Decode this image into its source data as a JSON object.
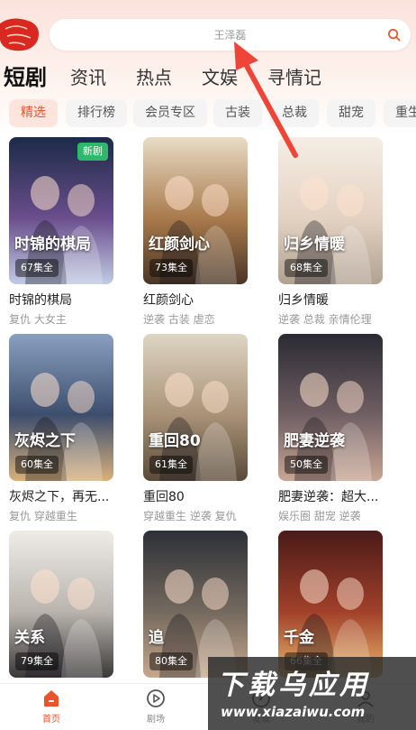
{
  "search": {
    "placeholder_text": "王泽磊"
  },
  "tabs": [
    {
      "label": "短剧",
      "active": true
    },
    {
      "label": "资讯"
    },
    {
      "label": "热点"
    },
    {
      "label": "文娱"
    },
    {
      "label": "寻情记"
    }
  ],
  "chips": [
    {
      "label": "精选",
      "active": true
    },
    {
      "label": "排行榜"
    },
    {
      "label": "会员专区"
    },
    {
      "label": "古装"
    },
    {
      "label": "总裁"
    },
    {
      "label": "甜宠"
    },
    {
      "label": "重生"
    }
  ],
  "dramas": [
    {
      "title": "时锦的棋局",
      "tags": "复仇 大女主",
      "episodes": "67集全",
      "badge": "新剧",
      "poster_text": "时锦的棋局",
      "colors": [
        "#1c2a48",
        "#6a4e8c",
        "#c1cbe4"
      ]
    },
    {
      "title": "红颜剑心",
      "tags": "逆袭 古装 虐恋",
      "episodes": "73集全",
      "poster_text": "红颜剑心",
      "colors": [
        "#e9dcc6",
        "#a97a4c",
        "#4a3526"
      ]
    },
    {
      "title": "归乡情暖",
      "tags": "逆袭 总裁 亲情伦理",
      "episodes": "68集全",
      "poster_text": "归乡情暖",
      "colors": [
        "#f5ede4",
        "#e4d2c2",
        "#b0a191"
      ]
    },
    {
      "title": "灰烬之下，再无...",
      "tags": "复仇 穿越重生",
      "episodes": "60集全",
      "poster_text": "灰烬之下",
      "colors": [
        "#8aa0c0",
        "#3d4e6d",
        "#d8b07c"
      ]
    },
    {
      "title": "重回80",
      "tags": "穿越重生 逆袭 复仇",
      "episodes": "61集全",
      "poster_text": "重回80",
      "colors": [
        "#ded5c4",
        "#a99277",
        "#5a4a38"
      ]
    },
    {
      "title": "肥妻逆袭：超大...",
      "tags": "娱乐圈 甜宠 逆袭",
      "episodes": "50集全",
      "poster_text": "肥妻逆袭",
      "colors": [
        "#2a2a33",
        "#705f63",
        "#c9a593"
      ]
    },
    {
      "title": "",
      "tags": "",
      "episodes": "79集全",
      "poster_text": "关系",
      "colors": [
        "#efece8",
        "#b9b4ae",
        "#3a3838"
      ]
    },
    {
      "title": "",
      "tags": "",
      "episodes": "80集全",
      "poster_text": "追",
      "colors": [
        "#2c3037",
        "#74695e",
        "#c7a88c"
      ]
    },
    {
      "title": "",
      "tags": "",
      "episodes": "66集全",
      "poster_text": "千金",
      "colors": [
        "#4a1a18",
        "#a1402a",
        "#e9b56a"
      ]
    }
  ],
  "nav": [
    {
      "label": "首页",
      "icon": "home-icon",
      "active": true
    },
    {
      "label": "剧场",
      "icon": "theater-icon"
    },
    {
      "label": "发现",
      "icon": "discover-icon"
    },
    {
      "label": "我的",
      "icon": "profile-icon"
    }
  ],
  "watermark": {
    "big": "下载乌应用",
    "small": "www.xiazaiwu.com"
  },
  "accent": "#e8542c"
}
